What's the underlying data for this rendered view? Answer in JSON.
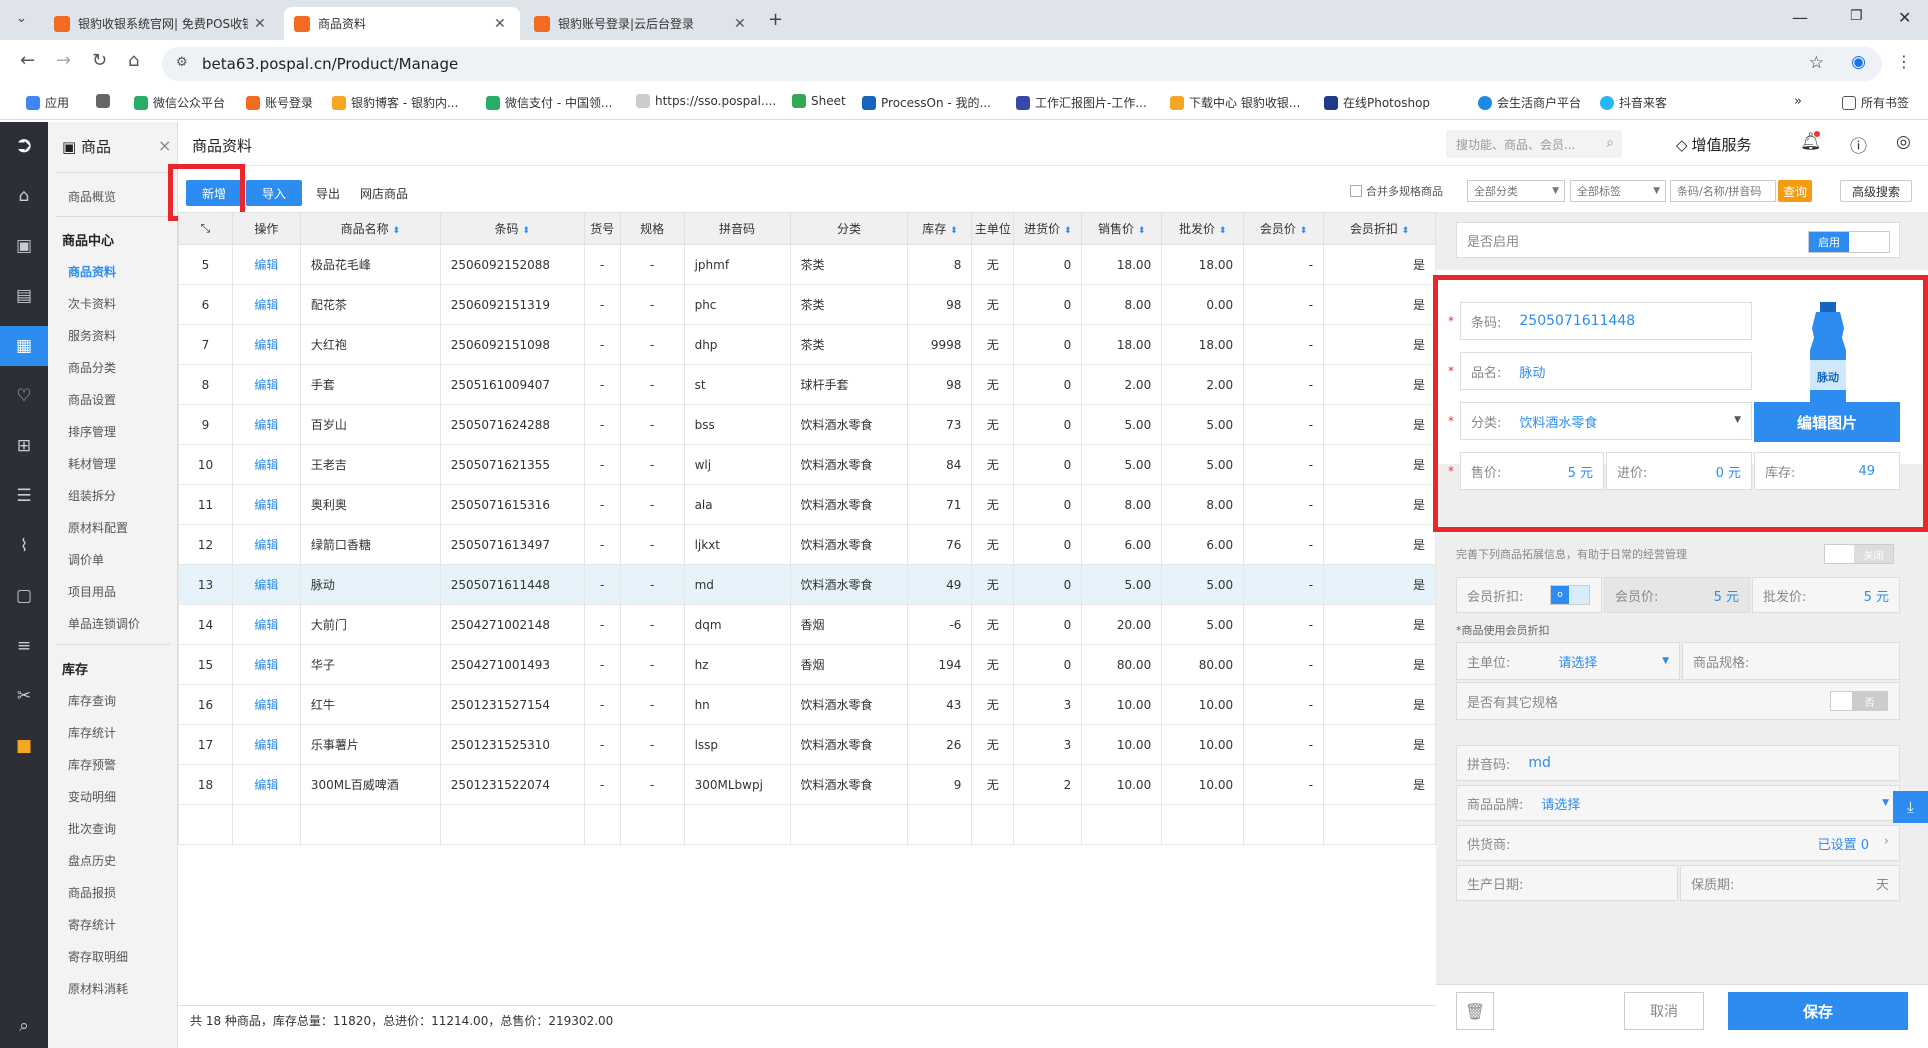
{
  "browser": {
    "tabs": [
      {
        "title": "银豹收银系统官网| 免费POS收银",
        "active": false
      },
      {
        "title": "商品资料",
        "active": true
      },
      {
        "title": "银豹账号登录|云后台登录",
        "active": false
      }
    ],
    "url": "beta63.pospal.cn/Product/Manage",
    "bookmarks": [
      "应用",
      "微信公众平台",
      "账号登录",
      "银豹博客 - 银豹内...",
      "微信支付 - 中国领...",
      "https://sso.pospal....",
      "Sheet",
      "ProcessOn - 我的...",
      "工作汇报图片-工作...",
      "下载中心 银豹收银...",
      "在线Photoshop",
      "会生活商户平台",
      "抖音来客",
      "所有书签"
    ]
  },
  "sidebar": {
    "title": "商品",
    "groups": [
      {
        "label": "",
        "items": [
          "商品概览"
        ]
      },
      {
        "label": "商品中心",
        "items": [
          "商品资料",
          "次卡资料",
          "服务资料",
          "商品分类",
          "商品设置",
          "排序管理",
          "耗材管理",
          "组装拆分",
          "原材料配置",
          "调价单",
          "项目用品",
          "单品连锁调价"
        ]
      },
      {
        "label": "库存",
        "items": [
          "库存查询",
          "库存统计",
          "库存预警",
          "变动明细",
          "批次查询",
          "盘点历史",
          "商品报损",
          "寄存统计",
          "寄存取明细",
          "原材料消耗"
        ]
      }
    ],
    "selected": "商品资料"
  },
  "header": {
    "page_title": "商品资料",
    "search_placeholder": "搜功能、商品、会员...",
    "vas_label": "增值服务"
  },
  "toolbar": {
    "add": "新增",
    "import": "导入",
    "export": "导出",
    "online": "网店商品",
    "merge_label": "合并多规格商品",
    "category_select": "全部分类",
    "tag_select": "全部标签",
    "search_placeholder": "条码/名称/拼音码",
    "query": "查询",
    "advanced": "高级搜索"
  },
  "table": {
    "headers": [
      "",
      "操作",
      "商品名称",
      "条码",
      "货号",
      "规格",
      "拼音码",
      "分类",
      "库存",
      "主单位",
      "进货价",
      "销售价",
      "批发价",
      "会员价",
      "会员折扣"
    ],
    "rows": [
      [
        "5",
        "编辑",
        "极品花毛峰",
        "2506092152088",
        "-",
        "-",
        "jphmf",
        "茶类",
        "8",
        "无",
        "0",
        "18.00",
        "18.00",
        "-",
        "是"
      ],
      [
        "6",
        "编辑",
        "配花茶",
        "2506092151319",
        "-",
        "-",
        "phc",
        "茶类",
        "98",
        "无",
        "0",
        "8.00",
        "0.00",
        "-",
        "是"
      ],
      [
        "7",
        "编辑",
        "大红袍",
        "2506092151098",
        "-",
        "-",
        "dhp",
        "茶类",
        "9998",
        "无",
        "0",
        "18.00",
        "18.00",
        "-",
        "是"
      ],
      [
        "8",
        "编辑",
        "手套",
        "2505161009407",
        "-",
        "-",
        "st",
        "球杆手套",
        "98",
        "无",
        "0",
        "2.00",
        "2.00",
        "-",
        "是"
      ],
      [
        "9",
        "编辑",
        "百岁山",
        "2505071624288",
        "-",
        "-",
        "bss",
        "饮料酒水零食",
        "73",
        "无",
        "0",
        "5.00",
        "5.00",
        "-",
        "是"
      ],
      [
        "10",
        "编辑",
        "王老吉",
        "2505071621355",
        "-",
        "-",
        "wlj",
        "饮料酒水零食",
        "84",
        "无",
        "0",
        "5.00",
        "5.00",
        "-",
        "是"
      ],
      [
        "11",
        "编辑",
        "奥利奥",
        "2505071615316",
        "-",
        "-",
        "ala",
        "饮料酒水零食",
        "71",
        "无",
        "0",
        "8.00",
        "8.00",
        "-",
        "是"
      ],
      [
        "12",
        "编辑",
        "绿箭口香糖",
        "2505071613497",
        "-",
        "-",
        "ljkxt",
        "饮料酒水零食",
        "76",
        "无",
        "0",
        "6.00",
        "6.00",
        "-",
        "是"
      ],
      [
        "13",
        "编辑",
        "脉动",
        "2505071611448",
        "-",
        "-",
        "md",
        "饮料酒水零食",
        "49",
        "无",
        "0",
        "5.00",
        "5.00",
        "-",
        "是"
      ],
      [
        "14",
        "编辑",
        "大前门",
        "2504271002148",
        "-",
        "-",
        "dqm",
        "香烟",
        "-6",
        "无",
        "0",
        "20.00",
        "5.00",
        "-",
        "是"
      ],
      [
        "15",
        "编辑",
        "华子",
        "2504271001493",
        "-",
        "-",
        "hz",
        "香烟",
        "194",
        "无",
        "0",
        "80.00",
        "80.00",
        "-",
        "是"
      ],
      [
        "16",
        "编辑",
        "红牛",
        "2501231527154",
        "-",
        "-",
        "hn",
        "饮料酒水零食",
        "43",
        "无",
        "3",
        "10.00",
        "10.00",
        "-",
        "是"
      ],
      [
        "17",
        "编辑",
        "乐事薯片",
        "2501231525310",
        "-",
        "-",
        "lssp",
        "饮料酒水零食",
        "26",
        "无",
        "3",
        "10.00",
        "10.00",
        "-",
        "是"
      ],
      [
        "18",
        "编辑",
        "300ML百威啤酒",
        "2501231522074",
        "-",
        "-",
        "300MLbwpj",
        "饮料酒水零食",
        "9",
        "无",
        "2",
        "10.00",
        "10.00",
        "-",
        "是"
      ]
    ],
    "highlight_row": 8
  },
  "footer": {
    "summary": "共 18 种商品，库存总量：11820，总进价：11214.00，总售价：219302.00"
  },
  "panel": {
    "enable_label": "是否启用",
    "enable_value": "启用",
    "barcode_label": "条码:",
    "barcode": "2505071611448",
    "name_label": "品名:",
    "name": "脉动",
    "category_label": "分类:",
    "category": "饮料酒水零食",
    "price_label": "售价:",
    "price": "5 元",
    "cost_label": "进价:",
    "cost": "0 元",
    "stock_label": "库存:",
    "stock": "49",
    "image_text": "脉动",
    "edit_image": "编辑图片",
    "ext_hint": "完善下列商品拓展信息，有助于日常的经营管理",
    "ext_toggle": "关闭",
    "member_discount_label": "会员折扣:",
    "member_discount_value": "o",
    "member_price_label": "会员价:",
    "member_price": "5 元",
    "wholesale_label": "批发价:",
    "wholesale": "5 元",
    "member_note": "*商品使用会员折扣",
    "unit_label": "主单位:",
    "unit_value": "请选择",
    "spec_label": "商品规格:",
    "other_spec_label": "是否有其它规格",
    "other_spec_value": "否",
    "pinyin_label": "拼音码:",
    "pinyin": "md",
    "brand_label": "商品品牌:",
    "brand": "请选择",
    "supplier_label": "供货商:",
    "supplier": "已设置 0",
    "prod_date_label": "生产日期:",
    "shelf_label": "保质期:",
    "shelf_unit": "天",
    "cancel": "取消",
    "save": "保存"
  }
}
